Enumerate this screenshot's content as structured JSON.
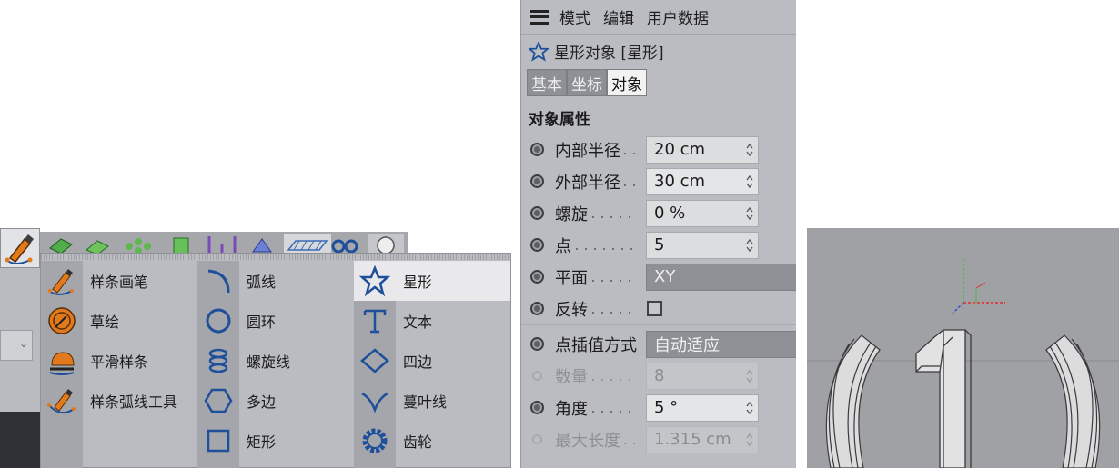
{
  "spline_palette": {
    "columns": [
      [
        {
          "label": "样条画笔",
          "icon": "spline-pen-icon"
        },
        {
          "label": "草绘",
          "icon": "sketch-icon"
        },
        {
          "label": "平滑样条",
          "icon": "smooth-spline-icon"
        },
        {
          "label": "样条弧线工具",
          "icon": "spline-arc-tool-icon"
        }
      ],
      [
        {
          "label": "弧线",
          "icon": "arc-icon"
        },
        {
          "label": "圆环",
          "icon": "circle-icon"
        },
        {
          "label": "螺旋线",
          "icon": "helix-icon"
        },
        {
          "label": "多边",
          "icon": "polygon-icon"
        },
        {
          "label": "矩形",
          "icon": "rectangle-icon"
        }
      ],
      [
        {
          "label": "星形",
          "icon": "star-icon",
          "selected": true
        },
        {
          "label": "文本",
          "icon": "text-icon"
        },
        {
          "label": "四边",
          "icon": "four-sides-icon"
        },
        {
          "label": "蔓叶线",
          "icon": "cissoid-icon"
        },
        {
          "label": "齿轮",
          "icon": "cogwheel-icon"
        }
      ]
    ]
  },
  "attributes": {
    "menu": [
      "模式",
      "编辑",
      "用户数据"
    ],
    "object_title": "星形对象 [星形]",
    "tabs": [
      {
        "label": "基本",
        "active": false
      },
      {
        "label": "坐标",
        "active": false
      },
      {
        "label": "对象",
        "active": true
      }
    ],
    "section": "对象属性",
    "rows": [
      {
        "label": "内部半径",
        "value": "20 cm",
        "type": "number"
      },
      {
        "label": "外部半径",
        "value": "30 cm",
        "type": "number"
      },
      {
        "label": "螺旋",
        "value": "0 %",
        "type": "number"
      },
      {
        "label": "点",
        "value": "5",
        "type": "number"
      },
      {
        "label": "平面",
        "value": "XY",
        "type": "dropdown"
      },
      {
        "label": "反转",
        "value": "",
        "type": "checkbox",
        "checked": false
      },
      {
        "label": "点插值方式",
        "value": "自动适应",
        "type": "dropdown"
      },
      {
        "label": "数量",
        "value": "8",
        "type": "number",
        "disabled": true
      },
      {
        "label": "角度",
        "value": "5 °",
        "type": "number"
      },
      {
        "label": "最大长度",
        "value": "1.315 cm",
        "type": "number",
        "disabled": true
      }
    ]
  },
  "colors": {
    "panel_bg": "#babcc1",
    "selected_item": "#e9e9eb",
    "icon_blue": "#2a5aa8",
    "icon_orange": "#e07a1c"
  }
}
